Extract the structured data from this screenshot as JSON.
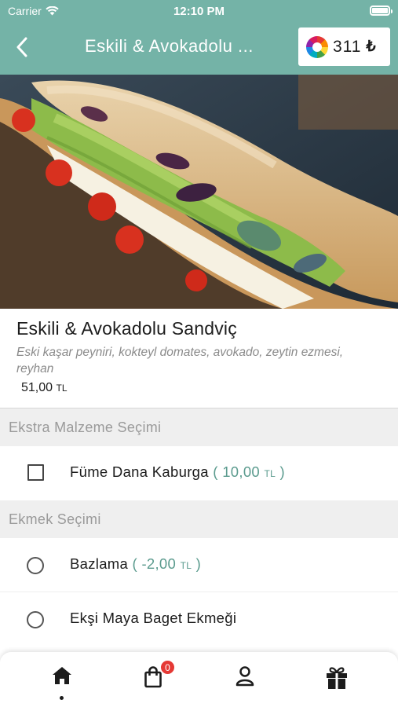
{
  "status_bar": {
    "carrier": "Carrier",
    "time": "12:10 PM"
  },
  "header": {
    "title": "Eskili & Avokadolu ...",
    "wallet": {
      "amount": "311",
      "currency": "₺"
    }
  },
  "product": {
    "name": "Eskili & Avokadolu Sandviç",
    "description": "Eski kaşar peyniri, kokteyl domates, avokado, zeytin ezmesi, reyhan",
    "price_value": "51,00",
    "price_unit": "TL"
  },
  "sections": [
    {
      "title": "Ekstra Malzeme Seçimi",
      "input_type": "checkbox",
      "options": [
        {
          "label": "Füme Dana Kaburga",
          "extra_open": "( ",
          "extra_value": "10,00",
          "extra_unit": "TL",
          "extra_close": " )",
          "selected": false
        }
      ]
    },
    {
      "title": "Ekmek Seçimi",
      "input_type": "radio",
      "options": [
        {
          "label": "Bazlama",
          "extra_open": "( ",
          "extra_value": "-2,00",
          "extra_unit": "TL",
          "extra_close": " )",
          "selected": false
        },
        {
          "label": "Ekşi Maya Baget Ekmeği",
          "selected": false
        }
      ]
    }
  ],
  "bottom_nav": {
    "items": [
      "home-icon",
      "shopping-bag-icon",
      "user-icon",
      "gift-icon"
    ],
    "active": "home-icon",
    "cart_count": "0"
  },
  "colors": {
    "brand": "#74b3a7",
    "price_accent": "#5b9b8e",
    "badge": "#e53935"
  }
}
